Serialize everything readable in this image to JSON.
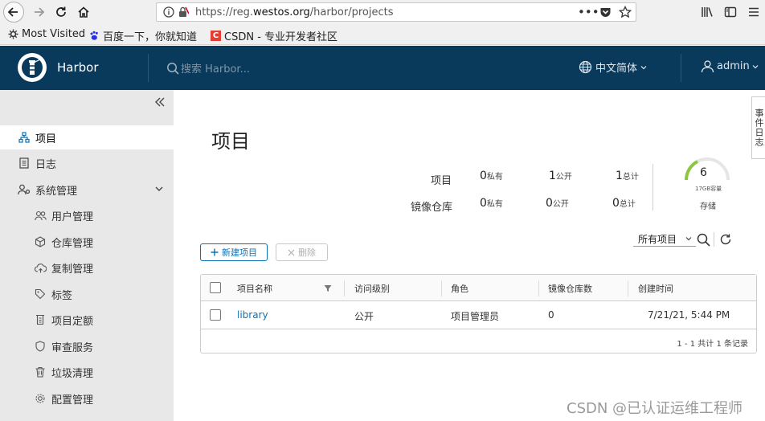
{
  "browser": {
    "url_prefix": "https://reg.",
    "url_domain": "westos.org",
    "url_path": "/harbor/projects",
    "bookmarks": [
      {
        "label": "Most Visited"
      },
      {
        "label": "百度一下，你就知道"
      },
      {
        "label": "CSDN - 专业开发者社区"
      }
    ]
  },
  "header": {
    "brand": "Harbor",
    "search_placeholder": "搜索 Harbor...",
    "language": "中文简体",
    "user": "admin"
  },
  "sidebar": {
    "items": [
      {
        "label": "项目"
      },
      {
        "label": "日志"
      },
      {
        "label": "系统管理"
      },
      {
        "label": "用户管理"
      },
      {
        "label": "仓库管理"
      },
      {
        "label": "复制管理"
      },
      {
        "label": "标签"
      },
      {
        "label": "项目定额"
      },
      {
        "label": "审查服务"
      },
      {
        "label": "垃圾清理"
      },
      {
        "label": "配置管理"
      }
    ]
  },
  "main": {
    "title": "项目",
    "stats": {
      "row1_label": "项目",
      "row2_label": "镜像仓库",
      "projects": {
        "private": "0",
        "public": "1",
        "total": "1"
      },
      "repos": {
        "private": "0",
        "public": "0",
        "total": "0"
      },
      "unit_private": "私有",
      "unit_public": "公开",
      "unit_total": "总计"
    },
    "storage": {
      "value": "6",
      "capacity": "17GB容量",
      "label": "存储"
    },
    "actions": {
      "new_project": "新建项目",
      "delete": "删除"
    },
    "filter": {
      "selected": "所有项目"
    },
    "table": {
      "columns": [
        "项目名称",
        "访问级别",
        "角色",
        "镜像仓库数",
        "创建时间"
      ],
      "rows": [
        {
          "name": "library",
          "access": "公开",
          "role": "项目管理员",
          "repos": "0",
          "created": "7/21/21, 5:44 PM"
        }
      ],
      "footer": "1 - 1 共计 1 条记录"
    },
    "side_tab": "事件日志"
  },
  "watermark": "CSDN @已认证运维工程师",
  "colors": {
    "header_bg": "#0a3a5b",
    "accent": "#0a71b6",
    "sidebar_bg": "#e8e8e8",
    "gauge": "#8dc63f"
  }
}
